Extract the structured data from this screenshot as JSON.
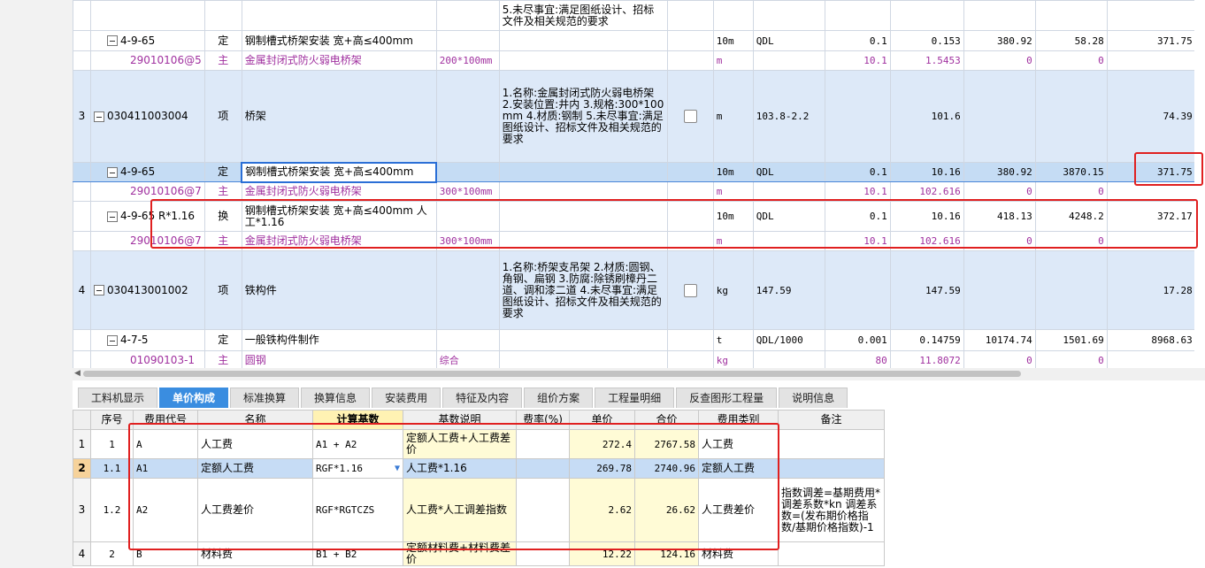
{
  "top_rows": [
    {
      "kind": "white",
      "rn": "",
      "code": "",
      "type": "",
      "name": "",
      "spec": "",
      "desc": "5.未尽事宜:满足图纸设计、招标文件及相关规范的要求",
      "unit": "",
      "expr": "",
      "content": "",
      "qty": "",
      "price": "",
      "total": "",
      "labor": ""
    },
    {
      "kind": "white",
      "rn": "",
      "code": "4-9-65",
      "type": "定",
      "name": "钢制槽式桥架安装 宽+高≤400mm",
      "spec": "",
      "desc": "",
      "unit": "10m",
      "expr": "QDL",
      "content": "0.1",
      "qty": "0.153",
      "price": "380.92",
      "total": "58.28",
      "labor": "371.75"
    },
    {
      "kind": "sub",
      "rn": "",
      "code": "29010106@5",
      "type": "主",
      "name": "金属封闭式防火弱电桥架",
      "spec": "200*100mm",
      "desc": "",
      "unit": "m",
      "expr": "",
      "content": "10.1",
      "qty": "1.5453",
      "price": "0",
      "total": "0",
      "labor": ""
    },
    {
      "kind": "blue",
      "rn": "3",
      "code": "030411003004",
      "type": "项",
      "name": "桥架",
      "spec": "",
      "desc": "1.名称:金属封闭式防火弱电桥架\n2.安装位置:井内\n3.规格:300*100mm\n4.材质:钢制\n5.未尽事宜:满足图纸设计、招标文件及相关规范的要求",
      "unit": "m",
      "expr": "103.8-2.2",
      "content": "",
      "qty": "101.6",
      "price": "",
      "total": "",
      "labor": "74.39"
    },
    {
      "kind": "sel",
      "rn": "",
      "code": "4-9-65",
      "type": "定",
      "name": "钢制槽式桥架安装 宽+高≤400mm",
      "spec": "",
      "desc": "",
      "unit": "10m",
      "expr": "QDL",
      "content": "0.1",
      "qty": "10.16",
      "price": "380.92",
      "total": "3870.15",
      "labor": "371.75"
    },
    {
      "kind": "sub",
      "rn": "",
      "code": "29010106@7",
      "type": "主",
      "name": "金属封闭式防火弱电桥架",
      "spec": "300*100mm",
      "desc": "",
      "unit": "m",
      "expr": "",
      "content": "10.1",
      "qty": "102.616",
      "price": "0",
      "total": "0",
      "labor": ""
    },
    {
      "kind": "white",
      "rn": "",
      "code": "4-9-65 R*1.16",
      "type": "换",
      "name": "钢制槽式桥架安装 宽+高≤400mm 人工*1.16",
      "spec": "",
      "desc": "",
      "unit": "10m",
      "expr": "QDL",
      "content": "0.1",
      "qty": "10.16",
      "price": "418.13",
      "total": "4248.2",
      "labor": "372.17"
    },
    {
      "kind": "sub",
      "rn": "",
      "code": "29010106@7",
      "type": "主",
      "name": "金属封闭式防火弱电桥架",
      "spec": "300*100mm",
      "desc": "",
      "unit": "m",
      "expr": "",
      "content": "10.1",
      "qty": "102.616",
      "price": "0",
      "total": "0",
      "labor": ""
    },
    {
      "kind": "blue",
      "rn": "4",
      "code": "030413001002",
      "type": "项",
      "name": "铁构件",
      "spec": "",
      "desc": "1.名称:桥架支吊架\n2.材质:圆钢、角钢、扁钢\n3.防腐:除锈刷樟丹二道、调和漆二道\n4.未尽事宜:满足图纸设计、招标文件及相关规范的要求",
      "unit": "kg",
      "expr": "147.59",
      "content": "",
      "qty": "147.59",
      "price": "",
      "total": "",
      "labor": "17.28"
    },
    {
      "kind": "white",
      "rn": "",
      "code": "4-7-5",
      "type": "定",
      "name": "一般铁构件制作",
      "spec": "",
      "desc": "",
      "unit": "t",
      "expr": "QDL/1000",
      "content": "0.001",
      "qty": "0.14759",
      "price": "10174.74",
      "total": "1501.69",
      "labor": "8968.63"
    },
    {
      "kind": "sub",
      "rn": "",
      "code": "01090103-1",
      "type": "主",
      "name": "圆钢",
      "spec": "综合",
      "desc": "",
      "unit": "kg",
      "expr": "",
      "content": "80",
      "qty": "11.8072",
      "price": "0",
      "total": "0",
      "labor": ""
    }
  ],
  "tabs": [
    "工料机显示",
    "单价构成",
    "标准换算",
    "换算信息",
    "安装费用",
    "特征及内容",
    "组价方案",
    "工程量明细",
    "反查图形工程量",
    "说明信息"
  ],
  "active_tab": "单价构成",
  "bottom_headers": [
    "序号",
    "费用代号",
    "名称",
    "计算基数",
    "基数说明",
    "费率(%)",
    "单价",
    "合价",
    "费用类别",
    "备注"
  ],
  "bottom_rows": [
    {
      "rn": "1",
      "seq": "1",
      "code": "A",
      "name": "人工费",
      "base": "A1 + A2",
      "base_desc": "定额人工费+人工费差价",
      "rate": "",
      "unit_price": "272.4",
      "total": "2767.58",
      "category": "人工费",
      "note": ""
    },
    {
      "rn": "2",
      "seq": "1.1",
      "code": "A1",
      "name": "定额人工费",
      "base": "RGF*1.16",
      "base_desc": "人工费*1.16",
      "rate": "",
      "unit_price": "269.78",
      "total": "2740.96",
      "category": "定额人工费",
      "note": ""
    },
    {
      "rn": "3",
      "seq": "1.2",
      "code": "A2",
      "name": "人工费差价",
      "base": "RGF*RGTCZS",
      "base_desc": "人工费*人工调差指数",
      "rate": "",
      "unit_price": "2.62",
      "total": "26.62",
      "category": "人工费差价",
      "note": "指数调差=基期费用*调差系数*kn\n调差系数=(发布期价格指数/基期价格指数)-1"
    },
    {
      "rn": "4",
      "seq": "2",
      "code": "B",
      "name": "材料费",
      "base": "B1 + B2",
      "base_desc": "定额材料费+材料费差价",
      "rate": "",
      "unit_price": "12.22",
      "total": "124.16",
      "category": "材料费",
      "note": ""
    }
  ],
  "colors": {
    "accent": "#3a8de0",
    "highlight_red": "#e02020",
    "row_blue": "#dde9f8",
    "sub_purple": "#a0309f"
  }
}
